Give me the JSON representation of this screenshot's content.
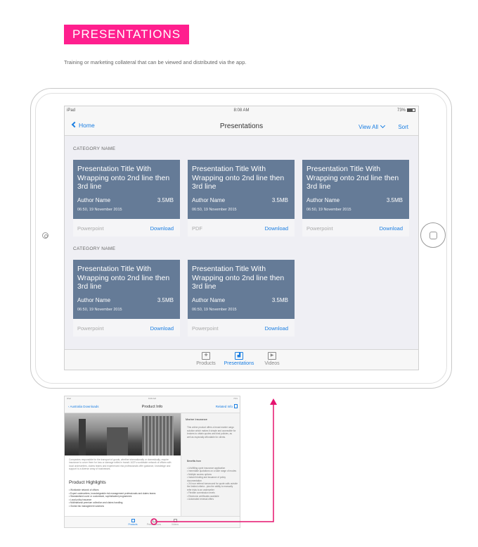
{
  "section": {
    "badge": "PRESENTATIONS",
    "subtitle": "Training or marketing collateral that can be viewed and distributed via the app.",
    "accent": "#ff1f8e"
  },
  "ipad": {
    "status": {
      "device": "iPad",
      "time": "8:08 AM",
      "battery": "73%"
    },
    "nav": {
      "back": "Home",
      "title": "Presentations",
      "view_all": "View All",
      "sort": "Sort"
    },
    "categories": [
      {
        "name": "CATEGORY NAME",
        "cards": [
          {
            "title": "Presentation Title With Wrapping onto 2nd line then 3rd line",
            "author": "Author Name",
            "size": "3.5MB",
            "date": "06:50, 19 November 2015",
            "type": "Powerpoint",
            "action": "Download"
          },
          {
            "title": "Presentation Title With Wrapping onto 2nd line then 3rd line",
            "author": "Author Name",
            "size": "3.5MB",
            "date": "06:50, 19 November 2015",
            "type": "PDF",
            "action": "Download"
          },
          {
            "title": "Presentation Title With Wrapping onto 2nd line then 3rd line",
            "author": "Author Name",
            "size": "3.5MB",
            "date": "06:50, 19 November 2015",
            "type": "Powerpoint",
            "action": "Download"
          }
        ]
      },
      {
        "name": "CATEGORY NAME",
        "cards": [
          {
            "title": "Presentation Title With Wrapping onto 2nd line then 3rd line",
            "author": "Author Name",
            "size": "3.5MB",
            "date": "06:50, 19 November 2015",
            "type": "Powerpoint",
            "action": "Download"
          },
          {
            "title": "Presentation Title With Wrapping onto 2nd line then 3rd line",
            "author": "Author Name",
            "size": "3.5MB",
            "date": "06:50, 19 November 2015",
            "type": "Powerpoint",
            "action": "Download"
          }
        ]
      }
    ],
    "tabs": [
      {
        "label": "Products",
        "icon": "products-icon",
        "active": false
      },
      {
        "label": "Presentations",
        "icon": "presentation-icon",
        "active": true
      },
      {
        "label": "Videos",
        "icon": "play-icon",
        "active": false
      }
    ]
  },
  "thumbnail": {
    "status": {
      "device": "iPad",
      "time": "8:08 AM",
      "battery": "73%"
    },
    "nav": {
      "back": "Australia Downloads",
      "title": "Product Info",
      "right": "Related Info"
    },
    "paragraph": "Companies responsible for the transport of goods, whether internationally or domestically, require insurance to cover them for loss or damage whilst in transit. ACE's worldwide network of offices with local underwriters, claims teams and experienced risk professionals offer guidance, knowledge and support to a diverse array of businesses.",
    "heading": "Product Highlights",
    "highlights": [
      "Worldwide network of offices",
      "Expert underwriters, knowledgeable risk management professionals and claims teams",
      "Standardised cover or customised, sophisticated programmes",
      "Local policy issuance",
      "Multinational premium collection and claims handling",
      "Global risk management solutions"
    ],
    "side": {
      "title": "Marine Insurance",
      "text": "This online product offers a broad marine cargo solution which makes it simple and accessible for brokers to obtain quotes and bind policies, as well as especially affordable for clients.",
      "benefits_title": "Benefits from",
      "benefits": [
        "A fulfilling cycle insurance application",
        "Immediate quotations on a wide range of modes",
        "Multiple access options",
        "Instant binding and issuance of policy documentation",
        "24 hour referral turnaround for quote calls outside the limited criteria - plus the ability to manually refer risks to an underwriter",
        "Flexible commission levels",
        "Electronic certificates available",
        "Automated renewal offers"
      ]
    },
    "tabs": [
      {
        "label": "Products",
        "active": true
      },
      {
        "label": "Presentations",
        "active": false
      },
      {
        "label": "Videos",
        "active": false
      }
    ]
  }
}
